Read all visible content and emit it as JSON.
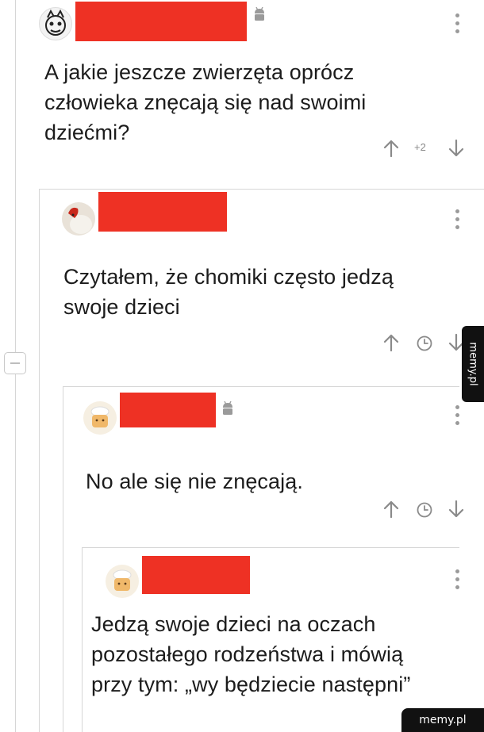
{
  "comments": [
    {
      "text_lines": [
        "A jakie jeszcze zwierzęta oprócz",
        "człowieka znęcają się nad swoimi",
        "dziećmi?"
      ],
      "score": "+2",
      "platform_icon": "android-icon"
    },
    {
      "text_lines": [
        "Czytałem, że chomiki często jedzą",
        "swoje dzieci"
      ]
    },
    {
      "text_lines": [
        "No ale się nie znęcają."
      ],
      "platform_icon": "android-icon"
    },
    {
      "text_lines": [
        "Jedzą swoje dzieci na oczach",
        "pozostałego rodzeństwa i mówią",
        "przy tym: „wy będziecie następni”"
      ]
    }
  ],
  "watermark": {
    "side": "memy.pl",
    "corner": "memy.pl"
  },
  "colors": {
    "redaction": "#ee3124",
    "icon_gray": "#8a8a8a",
    "thread_line": "#d6d6d6",
    "watermark_bg": "#111111"
  }
}
